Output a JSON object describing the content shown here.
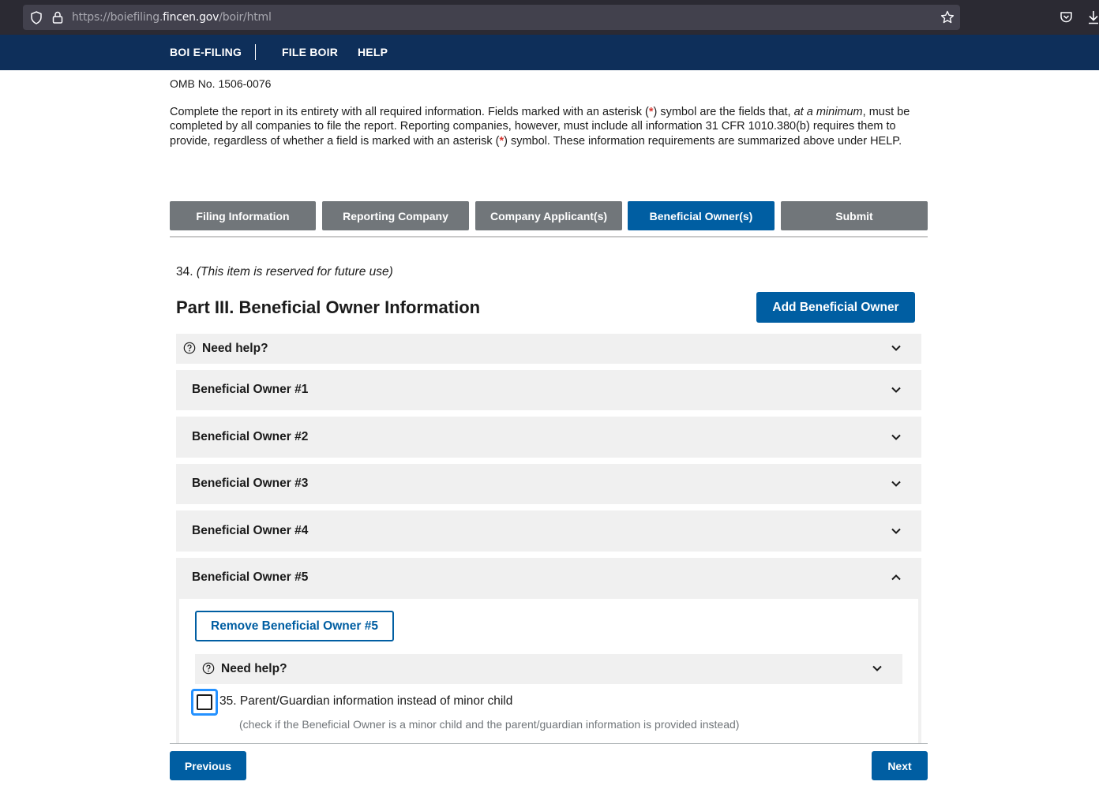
{
  "browser": {
    "url_prefix": "https://boiefiling.",
    "url_domain": "fincen.gov",
    "url_path": "/boir/html"
  },
  "nav": {
    "brand": "BOI E-FILING",
    "file": "FILE BOIR",
    "help": "HELP"
  },
  "omb": "OMB No. 1506-0076",
  "intro": {
    "p1": "Complete the report in its entirety with all required information. Fields marked with an asterisk (",
    "star": "*",
    "p2": ") symbol are the fields that, ",
    "italic": "at a minimum",
    "p3": ", must be completed by all companies to file the report. Reporting companies, however, must include all information 31 CFR 1010.380(b) requires them to provide, regardless of whether a field is marked with an asterisk (",
    "p4": ") symbol. These information requirements are summarized above under HELP."
  },
  "steps": [
    {
      "label": "Filing Information",
      "active": false
    },
    {
      "label": "Reporting Company",
      "active": false
    },
    {
      "label": "Company Applicant(s)",
      "active": false
    },
    {
      "label": "Beneficial Owner(s)",
      "active": true
    },
    {
      "label": "Submit",
      "active": false
    }
  ],
  "reserved": {
    "num": "34. ",
    "text": "(This item is reserved for future use)"
  },
  "part_title": "Part III. Beneficial Owner Information",
  "add_button": "Add Beneficial Owner",
  "need_help": "Need help?",
  "owners": [
    "Beneficial Owner #1",
    "Beneficial Owner #2",
    "Beneficial Owner #3",
    "Beneficial Owner #4",
    "Beneficial Owner #5"
  ],
  "remove_button": "Remove Beneficial Owner #5",
  "inner_help": "Need help?",
  "item35": {
    "label": "35. Parent/Guardian information instead of minor child",
    "hint": "(check if the Beneficial Owner is a minor child and the parent/guardian information is provided instead)",
    "checked": false
  },
  "footer": {
    "previous": "Previous",
    "next": "Next"
  },
  "colors": {
    "nav_bg": "#0e2f5a",
    "primary": "#005ea2",
    "tab_inactive": "#71767a",
    "accordion_bg": "#f0f0f0",
    "required_star": "#d83933"
  }
}
